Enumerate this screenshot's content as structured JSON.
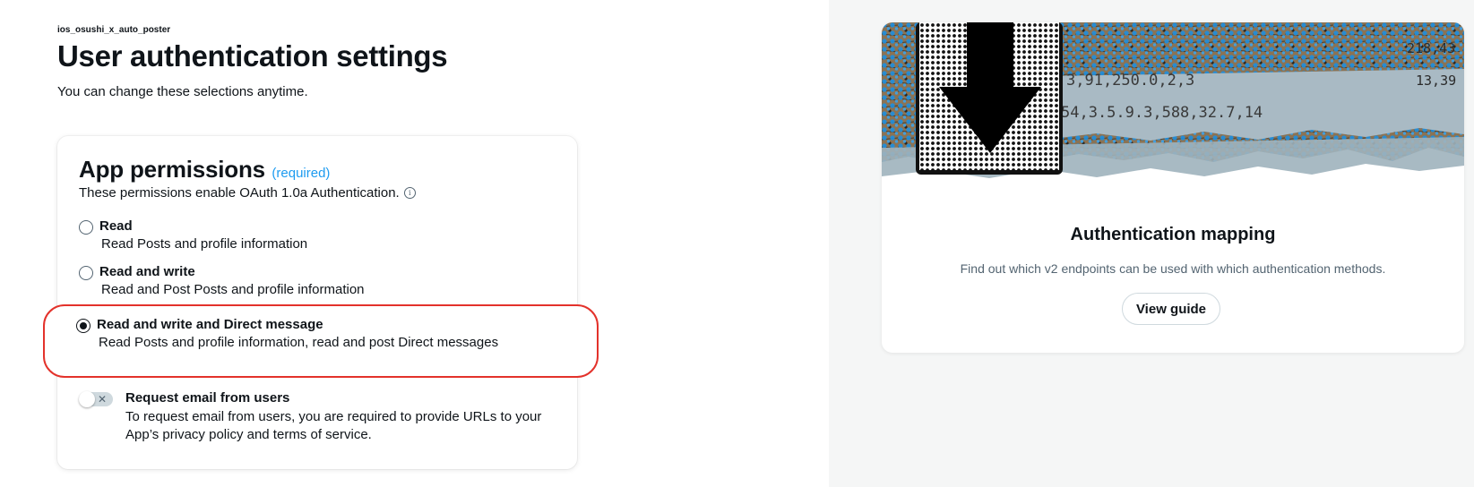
{
  "header": {
    "app_name": "ios_osushi_x_auto_poster",
    "title": "User authentication settings",
    "subtitle": "You can change these selections anytime."
  },
  "permissions": {
    "title": "App permissions",
    "required_label": "(required)",
    "description": "These permissions enable OAuth 1.0a Authentication.",
    "options": [
      {
        "label": "Read",
        "description": "Read Posts and profile information",
        "selected": false
      },
      {
        "label": "Read and write",
        "description": "Read and Post Posts and profile information",
        "selected": false
      },
      {
        "label": "Read and write and Direct message",
        "description": "Read Posts and profile information, read and post Direct messages",
        "selected": true
      }
    ],
    "email": {
      "title": "Request email from users",
      "description": "To request email from users, you are required to provide URLs to your App’s privacy policy and terms of service.",
      "enabled": false,
      "toggle_glyph": "✕"
    }
  },
  "auth_mapping": {
    "title": "Authentication mapping",
    "description": "Find out which v2 endpoints can be used with which authentication methods.",
    "button_label": "View guide",
    "banner_numbers": {
      "line1": "3,91,250.0,2,3",
      "line2": "54,3.5.9.3,588,32.7,14",
      "line3": "218,43",
      "line4": "13,39"
    }
  },
  "colors": {
    "accent": "#1d9bf0",
    "highlight": "#e3322b",
    "text": "#0f1419",
    "muted": "#536471"
  }
}
